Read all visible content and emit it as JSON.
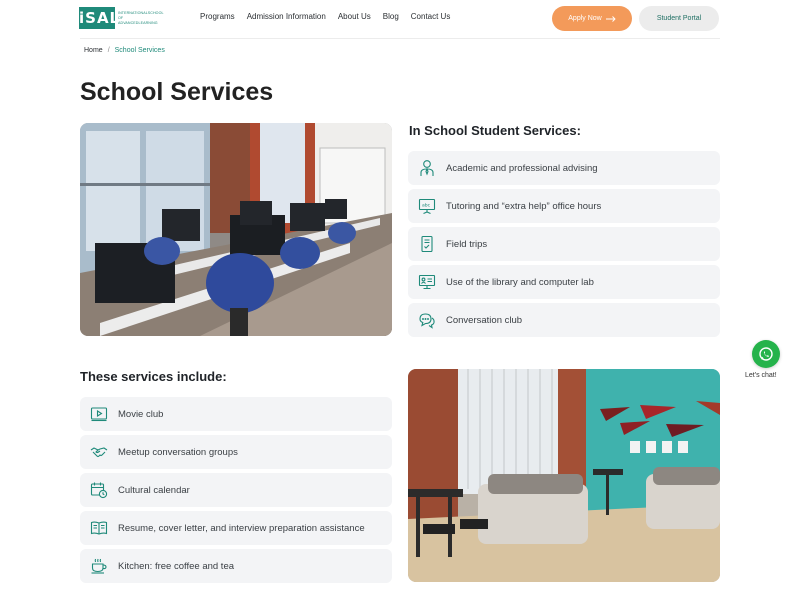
{
  "colors": {
    "accent": "#1f8a7a",
    "apply": "#f39a5a",
    "portal_bg": "#ececec",
    "item_bg": "#f3f4f6",
    "chat": "#25b34b"
  },
  "header": {
    "logo_mark": "iSAL",
    "logo_text": "INTERNATIONALSCHOOL OF ADVANCEDLEARNING",
    "nav": [
      "Programs",
      "Admission Information",
      "About Us",
      "Blog",
      "Contact Us"
    ],
    "apply_label": "Apply Now",
    "portal_label": "Student Portal"
  },
  "breadcrumb": {
    "home": "Home",
    "separator": "/",
    "current": "School Services"
  },
  "page_title": "School Services",
  "student_services": {
    "title": "In School Student Services:",
    "items": [
      {
        "label": "Academic and professional advising",
        "icon": "advisor-icon"
      },
      {
        "label": "Tutoring and “extra help” office hours",
        "icon": "whiteboard-icon"
      },
      {
        "label": "Field trips",
        "icon": "document-check-icon"
      },
      {
        "label": "Use of the library and computer lab",
        "icon": "computer-lab-icon"
      },
      {
        "label": "Conversation club",
        "icon": "chat-bubbles-icon"
      }
    ]
  },
  "included_services": {
    "title": "These services include:",
    "items": [
      {
        "label": "Movie club",
        "icon": "video-icon"
      },
      {
        "label": "Meetup conversation groups",
        "icon": "handshake-icon"
      },
      {
        "label": "Cultural calendar",
        "icon": "calendar-clock-icon"
      },
      {
        "label": "Resume, cover letter, and interview preparation assistance",
        "icon": "open-book-icon"
      },
      {
        "label": "Kitchen: free coffee and tea",
        "icon": "coffee-cup-icon"
      }
    ]
  },
  "chat": {
    "label": "Let's chat!",
    "icon": "whatsapp-icon"
  }
}
